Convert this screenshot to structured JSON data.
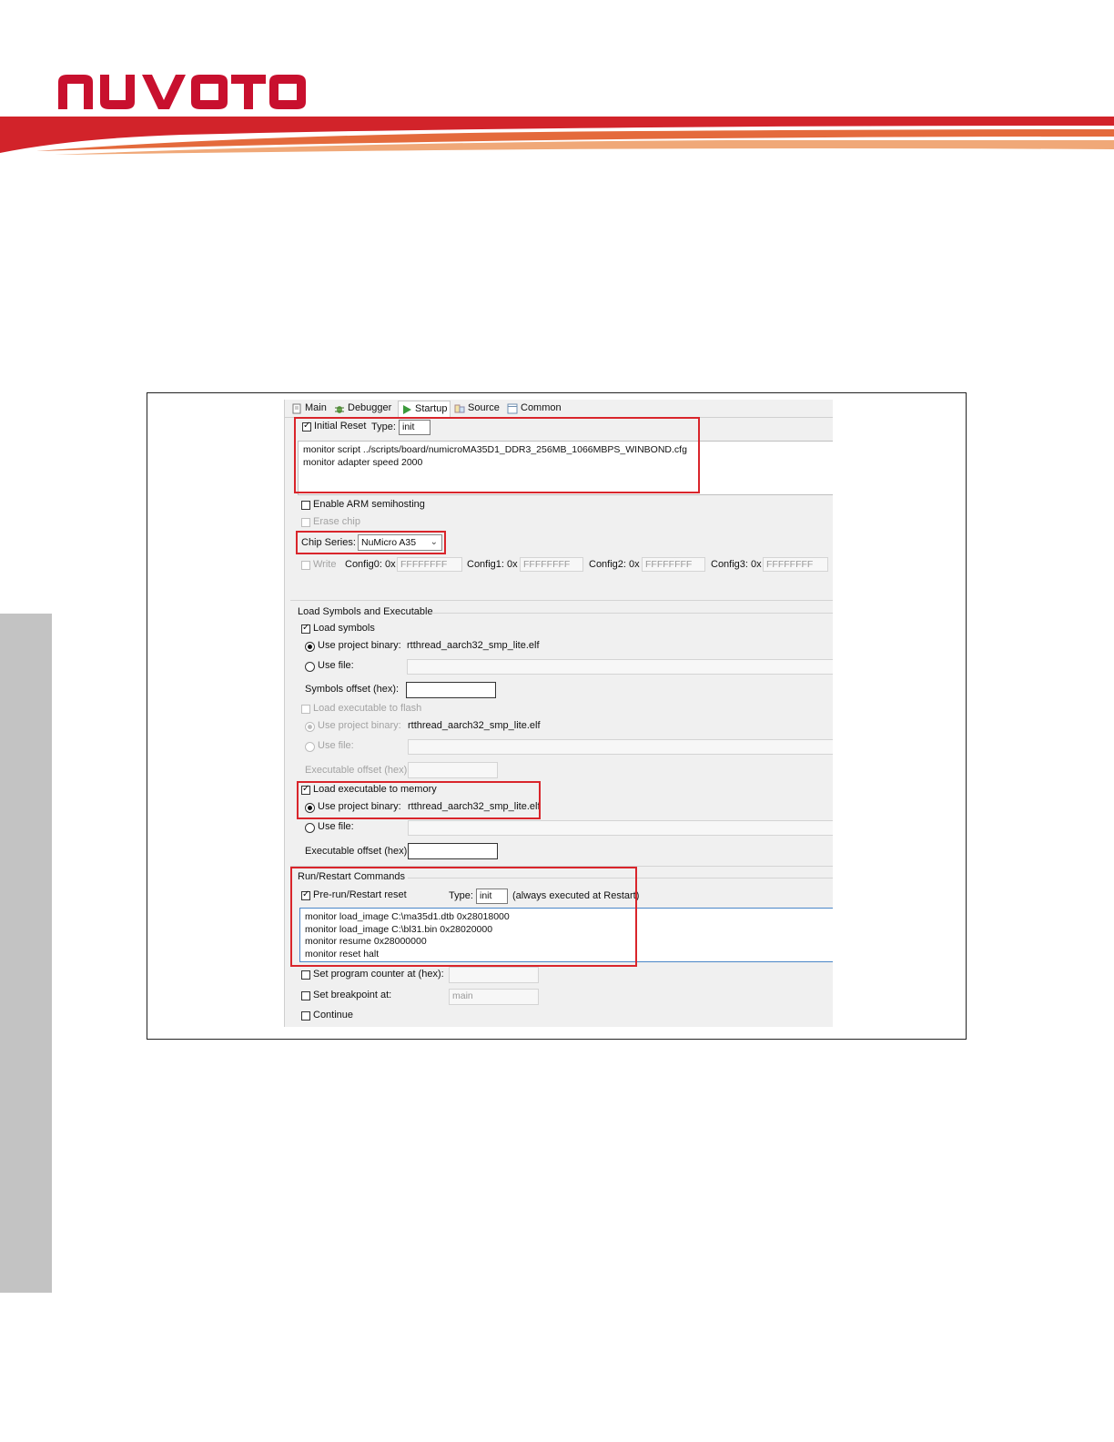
{
  "brand": {
    "logo_text": "nuvoTon"
  },
  "tabs": [
    {
      "label": "Main",
      "icon": "document-icon"
    },
    {
      "label": "Debugger",
      "icon": "bug-icon"
    },
    {
      "label": "Startup",
      "icon": "play-icon"
    },
    {
      "label": "Source",
      "icon": "source-icon"
    },
    {
      "label": "Common",
      "icon": "window-icon"
    }
  ],
  "active_tab": "Startup",
  "initial_reset": {
    "checkbox_label": "Initial Reset",
    "checked": true,
    "type_label": "Type:",
    "type_value": "init",
    "commands": [
      "monitor script ../scripts/board/numicroMA35D1_DDR3_256MB_1066MBPS_WINBOND.cfg",
      "monitor adapter speed 2000"
    ]
  },
  "semihosting": {
    "label": "Enable ARM semihosting",
    "checked": false
  },
  "erase_chip": {
    "label": "Erase chip",
    "checked": false,
    "enabled": false
  },
  "chip_series": {
    "label": "Chip Series:",
    "value": "NuMicro A35"
  },
  "config": {
    "write_label": "Write",
    "fields": [
      {
        "label": "Config0: 0x",
        "value": "FFFFFFFF"
      },
      {
        "label": "Config1: 0x",
        "value": "FFFFFFFF"
      },
      {
        "label": "Config2: 0x",
        "value": "FFFFFFFF"
      },
      {
        "label": "Config3: 0x",
        "value": "FFFFFFFF"
      }
    ]
  },
  "load_symbols_section": {
    "title": "Load Symbols and Executable",
    "load_symbols_label": "Load symbols",
    "use_project_binary_label": "Use project binary:",
    "project_binary_value": "rtthread_aarch32_smp_lite.elf",
    "use_file_label": "Use file:",
    "symbols_offset_label": "Symbols offset (hex):",
    "load_exec_flash_label": "Load executable to flash",
    "flash_project_binary_label": "Use project binary:",
    "flash_project_binary_value": "rtthread_aarch32_smp_lite.elf",
    "flash_use_file_label": "Use file:",
    "flash_exec_offset_label": "Executable offset (hex):",
    "load_exec_memory_label": "Load executable to memory",
    "mem_project_binary_label": "Use project binary:",
    "mem_project_binary_value": "rtthread_aarch32_smp_lite.elf",
    "mem_use_file_label": "Use file:",
    "mem_exec_offset_label": "Executable offset (hex):"
  },
  "run_restart": {
    "title": "Run/Restart Commands",
    "prerun_label": "Pre-run/Restart reset",
    "type_label": "Type:",
    "type_value": "init",
    "note": "(always executed at Restart)",
    "commands": [
      "monitor load_image C:\\ma35d1.dtb 0x28018000",
      "monitor load_image C:\\bl31.bin 0x28020000",
      "monitor resume 0x28000000",
      "monitor reset halt"
    ]
  },
  "set_pc": {
    "label": "Set program counter at (hex):"
  },
  "breakpoint": {
    "label": "Set breakpoint at:",
    "value": "main"
  },
  "continue": {
    "label": "Continue"
  },
  "colors": {
    "highlight": "#d9252b",
    "brand_red": "#c8102e",
    "banner_orange": "#e87a4a"
  }
}
